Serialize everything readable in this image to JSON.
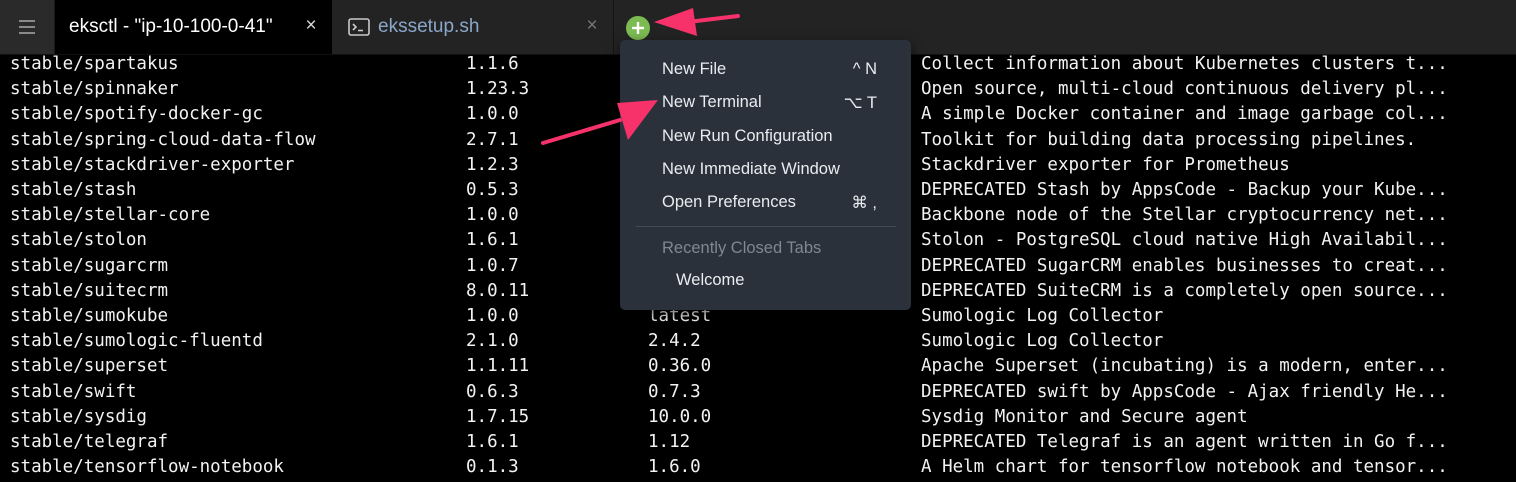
{
  "tabbar": {
    "menu_icon": "hamburger-icon",
    "tabs": [
      {
        "title": "eksctl - \"ip-10-100-0-41\"",
        "close": "×",
        "active": true
      },
      {
        "title": "ekssetup.sh",
        "close": "×",
        "active": false,
        "icon": "terminal-icon"
      }
    ],
    "add_tab_icon": "plus-icon",
    "accent_color": "#7cbb52"
  },
  "terminal": {
    "rows": [
      {
        "name": "stable/spartakus",
        "version": "1.1.6",
        "app_version": "",
        "description": "Collect information about Kubernetes clusters t..."
      },
      {
        "name": "stable/spinnaker",
        "version": "1.23.3",
        "app_version": "",
        "description": "Open source, multi-cloud continuous delivery pl..."
      },
      {
        "name": "stable/spotify-docker-gc",
        "version": "1.0.0",
        "app_version": "",
        "description": "A simple Docker container and image garbage col..."
      },
      {
        "name": "stable/spring-cloud-data-flow",
        "version": "2.7.1",
        "app_version": "",
        "description": "Toolkit for building data processing pipelines."
      },
      {
        "name": "stable/stackdriver-exporter",
        "version": "1.2.3",
        "app_version": "",
        "description": "Stackdriver exporter for Prometheus"
      },
      {
        "name": "stable/stash",
        "version": "0.5.3",
        "app_version": "",
        "description": "DEPRECATED Stash by AppsCode - Backup your Kube..."
      },
      {
        "name": "stable/stellar-core",
        "version": "1.0.0",
        "app_version": "",
        "description": "Backbone node of the Stellar cryptocurrency net..."
      },
      {
        "name": "stable/stolon",
        "version": "1.6.1",
        "app_version": "",
        "description": "Stolon - PostgreSQL cloud native High Availabil..."
      },
      {
        "name": "stable/sugarcrm",
        "version": "1.0.7",
        "app_version": "",
        "description": "DEPRECATED SugarCRM enables businesses to creat..."
      },
      {
        "name": "stable/suitecrm",
        "version": "8.0.11",
        "app_version": "",
        "description": "DEPRECATED SuiteCRM is a completely open source..."
      },
      {
        "name": "stable/sumokube",
        "version": "1.0.0",
        "app_version": "latest",
        "description": "Sumologic Log Collector"
      },
      {
        "name": "stable/sumologic-fluentd",
        "version": "2.1.0",
        "app_version": "2.4.2",
        "description": "Sumologic Log Collector"
      },
      {
        "name": "stable/superset",
        "version": "1.1.11",
        "app_version": "0.36.0",
        "description": "Apache Superset (incubating) is a modern, enter..."
      },
      {
        "name": "stable/swift",
        "version": "0.6.3",
        "app_version": "0.7.3",
        "description": "DEPRECATED swift by AppsCode - Ajax friendly He..."
      },
      {
        "name": "stable/sysdig",
        "version": "1.7.15",
        "app_version": "10.0.0",
        "description": "Sysdig Monitor and Secure agent"
      },
      {
        "name": "stable/telegraf",
        "version": "1.6.1",
        "app_version": "1.12",
        "description": "DEPRECATED Telegraf is an agent written in Go f..."
      },
      {
        "name": "stable/tensorflow-notebook",
        "version": "0.1.3",
        "app_version": "1.6.0",
        "description": "A Helm chart for tensorflow notebook and tensor..."
      }
    ]
  },
  "dropdown": {
    "items": [
      {
        "label": "New File",
        "shortcut": "^ N"
      },
      {
        "label": "New Terminal",
        "shortcut": "⌥ T"
      },
      {
        "label": "New Run Configuration",
        "shortcut": ""
      },
      {
        "label": "New Immediate Window",
        "shortcut": ""
      },
      {
        "label": "Open Preferences",
        "shortcut": "⌘ ,"
      }
    ],
    "recent_section_label": "Recently Closed Tabs",
    "recent_items": [
      "Welcome"
    ]
  },
  "annotations": {
    "arrow_color": "#f7326b"
  }
}
